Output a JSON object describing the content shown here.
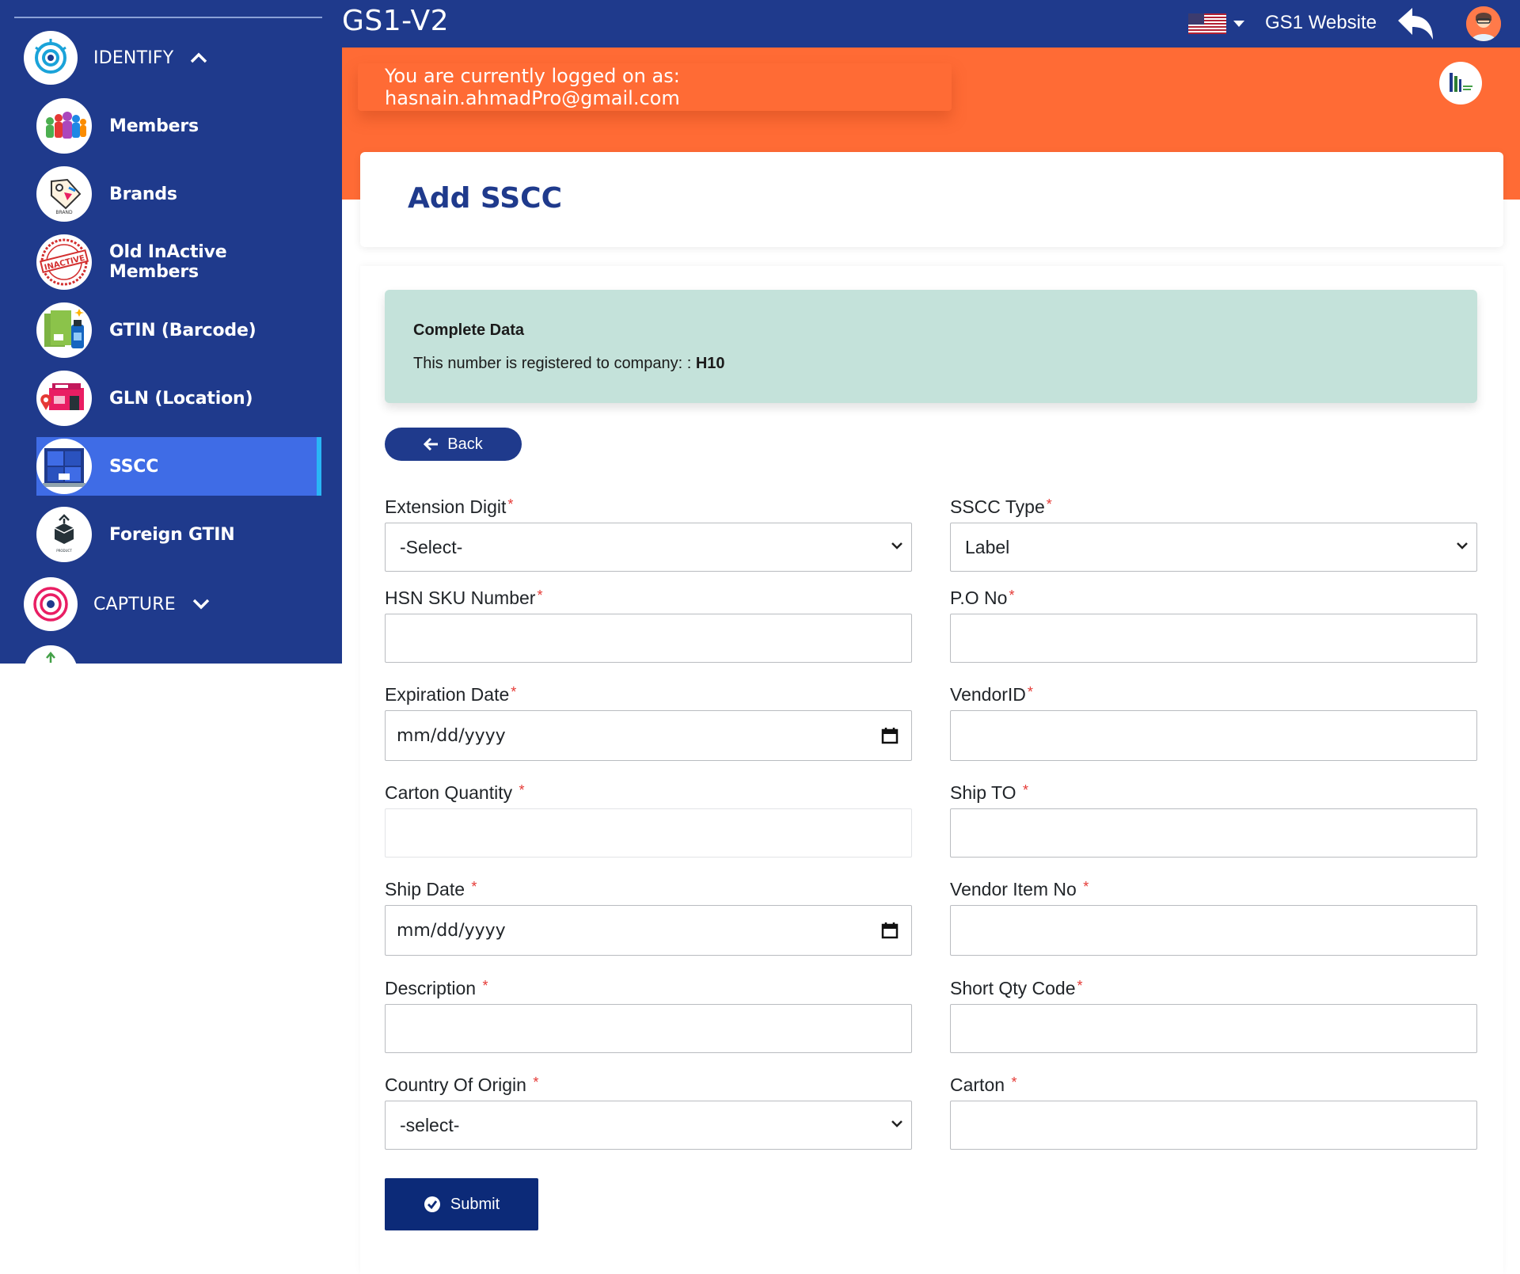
{
  "app": {
    "title": "GS1-V2"
  },
  "header": {
    "site_link": "GS1 Website",
    "flag_icon": "us-flag-icon",
    "back_icon": "reply-arrow-icon",
    "avatar_icon": "user-avatar-icon"
  },
  "banner": {
    "login_text": "You are currently logged on as: hasnain.ahmadPro@gmail.com",
    "accent_color": "#ff6b35"
  },
  "sidebar": {
    "sections": [
      {
        "label": "IDENTIFY",
        "icon": "eye-icon",
        "expanded": true
      },
      {
        "label": "CAPTURE",
        "icon": "target-icon",
        "expanded": false
      }
    ],
    "items": [
      {
        "label": "Members",
        "icon": "members-icon"
      },
      {
        "label": "Brands",
        "icon": "brand-tag-icon"
      },
      {
        "label": "Old InActive Members",
        "icon": "inactive-stamp-icon"
      },
      {
        "label": "GTIN (Barcode)",
        "icon": "barcode-product-icon"
      },
      {
        "label": "GLN (Location)",
        "icon": "location-store-icon"
      },
      {
        "label": "SSCC",
        "icon": "pallet-box-icon",
        "active": true
      },
      {
        "label": "Foreign GTIN",
        "icon": "product-box-icon"
      }
    ],
    "bg_color": "#1f3a8c",
    "active_color": "#3f6ce6"
  },
  "page": {
    "title": "Add SSCC"
  },
  "info": {
    "title": "Complete Data",
    "text": "This number is registered to company: :",
    "company": "H10"
  },
  "buttons": {
    "back": "Back",
    "submit": "Submit"
  },
  "form": {
    "extension_digit": {
      "label": "Extension Digit",
      "value": "-Select-"
    },
    "sscc_type": {
      "label": "SSCC Type",
      "value": "Label"
    },
    "hsn_sku": {
      "label": "HSN SKU Number",
      "value": ""
    },
    "po_no": {
      "label": "P.O No",
      "value": ""
    },
    "expiration_date": {
      "label": "Expiration Date",
      "placeholder": "mm/dd/yyyy"
    },
    "vendor_id": {
      "label": "VendorID",
      "value": ""
    },
    "carton_quantity": {
      "label": "Carton Quantity ",
      "value": ""
    },
    "ship_to": {
      "label": "Ship TO ",
      "value": ""
    },
    "ship_date": {
      "label": "Ship Date ",
      "placeholder": "mm/dd/yyyy"
    },
    "vendor_item_no": {
      "label": "Vendor Item No ",
      "value": ""
    },
    "description": {
      "label": "Description ",
      "value": ""
    },
    "short_qty_code": {
      "label": "Short Qty Code",
      "value": ""
    },
    "country_of_origin": {
      "label": "Country Of Origin ",
      "value": "-select-"
    },
    "carton": {
      "label": "Carton ",
      "value": ""
    },
    "required_mark": "*"
  }
}
